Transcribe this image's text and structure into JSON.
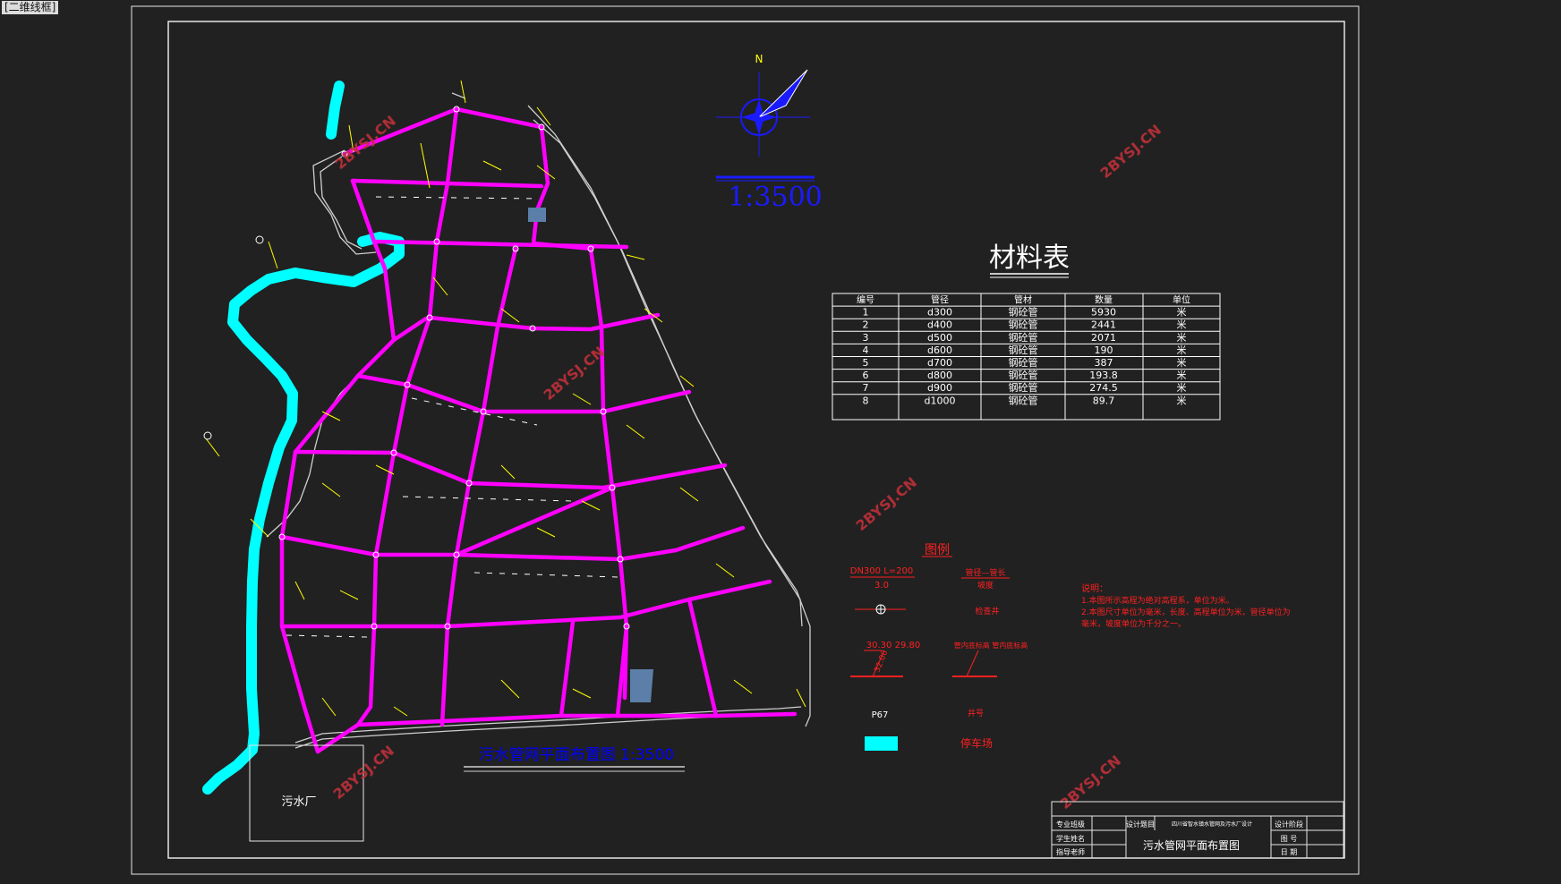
{
  "window": {
    "title": "[二维线框]"
  },
  "drawing": {
    "plan_title": "污水管网平面布置图 1:3500",
    "scale_label": "1:3500",
    "north_label": "N",
    "plant_label": "污水厂",
    "watermark": "2BYSJ.CN"
  },
  "material_table": {
    "title": "材料表",
    "headers": [
      "编号",
      "管径",
      "管材",
      "数量",
      "单位"
    ],
    "rows": [
      [
        "1",
        "d300",
        "钢砼管",
        "5930",
        "米"
      ],
      [
        "2",
        "d400",
        "钢砼管",
        "2441",
        "米"
      ],
      [
        "3",
        "d500",
        "钢砼管",
        "2071",
        "米"
      ],
      [
        "4",
        "d600",
        "钢砼管",
        "190",
        "米"
      ],
      [
        "5",
        "d700",
        "钢砼管",
        "387",
        "米"
      ],
      [
        "6",
        "d800",
        "钢砼管",
        "193.8",
        "米"
      ],
      [
        "7",
        "d900",
        "钢砼管",
        "274.5",
        "米"
      ],
      [
        "8",
        "d1000",
        "钢砼管",
        "89.7",
        "米"
      ]
    ]
  },
  "legend": {
    "title": "图例",
    "pipe_sample_top": "DN300  L=200",
    "pipe_sample_bottom": "3.0",
    "pipe_desc_top": "管径—管长",
    "pipe_desc_bottom": "坡度",
    "manhole_desc": "检查井",
    "elev_sample": "30.30 29.80",
    "elev_slope": "32.00",
    "elev_desc": "管内底标高 管内底标高",
    "node_sample": "P67",
    "node_desc": "井号",
    "parking_desc": "停车场"
  },
  "notes": {
    "heading": "说明：",
    "line1": "1.本图所示高程为绝对高程系，单位为米。",
    "line2": "2.本图尺寸单位为毫米，长度、高程单位为米，管径单位为",
    "line3": "毫米，坡度单位为千分之一。"
  },
  "title_block": {
    "major_label": "专业班级",
    "student_label": "学生姓名",
    "advisor_label": "指导老师",
    "project_label": "设计题目",
    "project_value": "四川省智水镇水管网及污水厂设计",
    "drawing_name": "污水管网平面布置图",
    "stage_label": "设计阶段",
    "sheet_label": "图 号",
    "date_label": "日 期"
  },
  "colors": {
    "pipe": "#ff00ff",
    "road": "#cfcfcf",
    "river": "#00ffff",
    "annotation": "#ffff00",
    "legend_red": "#ff2020",
    "compass_blue": "#1a1aff",
    "parking": "#5b7fa8",
    "background": "#212121"
  }
}
